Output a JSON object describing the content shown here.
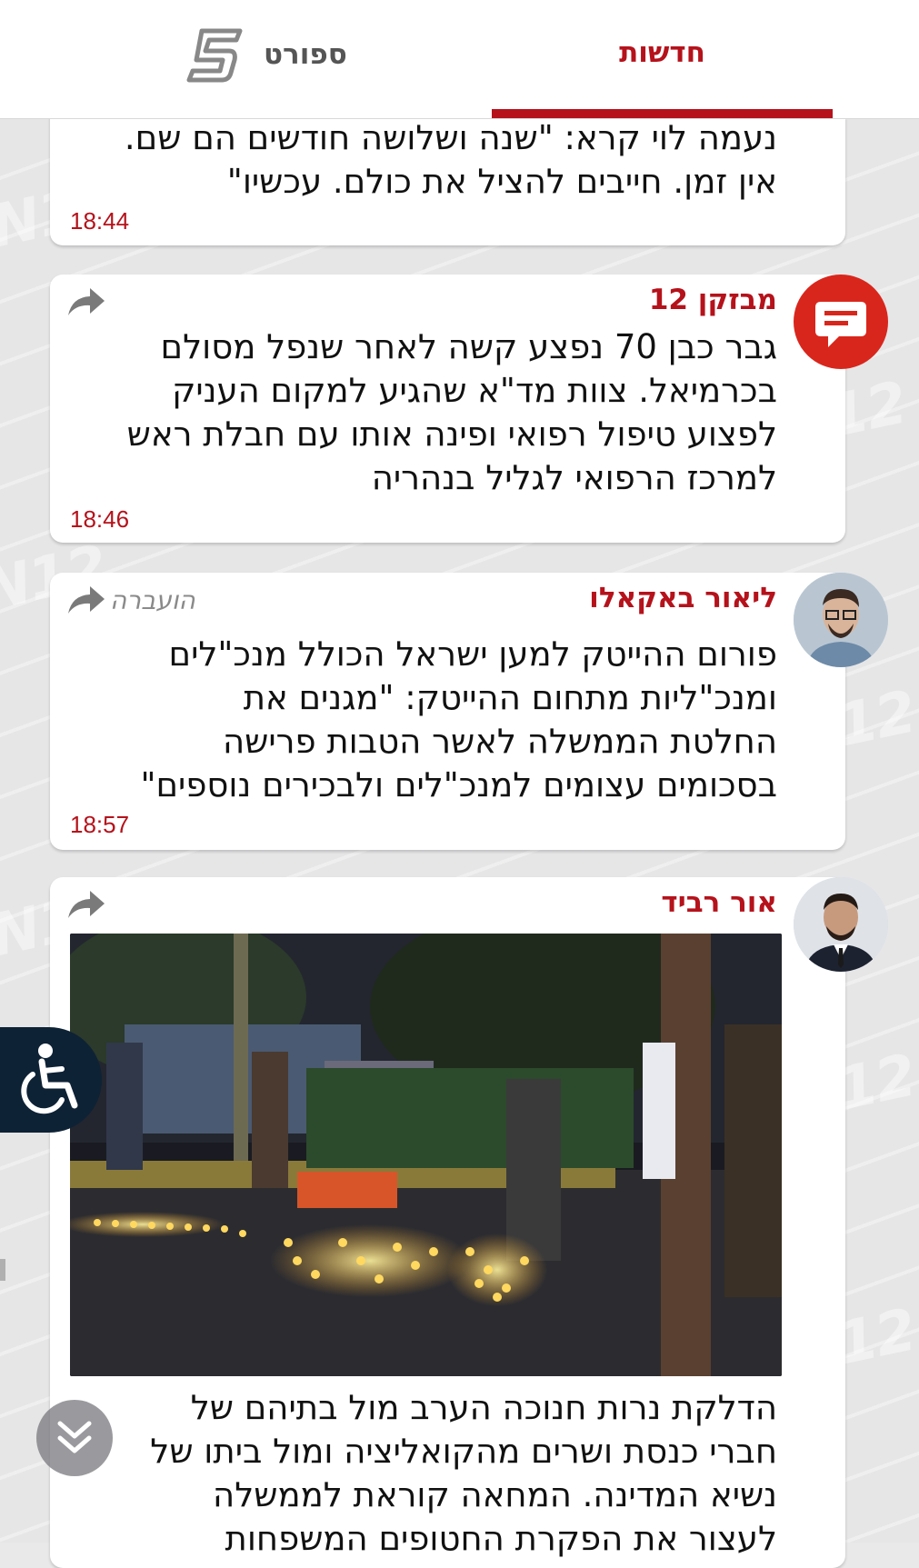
{
  "tabs": {
    "news_label": "חדשות",
    "sport_label": "ספורט",
    "active_color": "#b5121b"
  },
  "feed": [
    {
      "text_lines": [
        "נעמה לוי קרא: \"שנה ושלושה חודשים הם שם.",
        "אין זמן. חייבים להציל את כולם. עכשיו\""
      ],
      "time": "18:44"
    },
    {
      "author": "מבזקן 12",
      "avatar": "chat-bubble-icon",
      "text_lines": [
        "גבר כבן 70 נפצע קשה לאחר שנפל מסולם",
        "בכרמיאל. צוות מד\"א שהגיע למקום העניק",
        "לפצוע טיפול רפואי ופינה אותו עם חבלת ראש",
        "למרכז הרפואי לגליל בנהריה"
      ],
      "time": "18:46"
    },
    {
      "author": "ליאור באקאלו",
      "forwarded_label": "הועברה",
      "text_lines": [
        "פורום ההייטק למען ישראל הכולל מנכ\"לים",
        "ומנכ\"ליות מתחום ההייטק: \"מגנים את",
        "החלטת הממשלה לאשר הטבות פרישה",
        "בסכומים עצומים למנכ\"לים ולבכירים נוספים\""
      ],
      "time": "18:57"
    },
    {
      "author": "אור רביד",
      "photo_caption_hidden": "",
      "text_lines": [
        "הדלקת נרות חנוכה הערב מול בתיהם של",
        "חברי כנסת ושרים מהקואליציה ומול ביתו של",
        "נשיא המדינה. המחאה קוראת לממשלה",
        "לעצור את הפקרת החטופים המשפחות"
      ]
    }
  ],
  "colors": {
    "brand_red": "#b5121b",
    "accessibility_bg": "#0e2236"
  }
}
